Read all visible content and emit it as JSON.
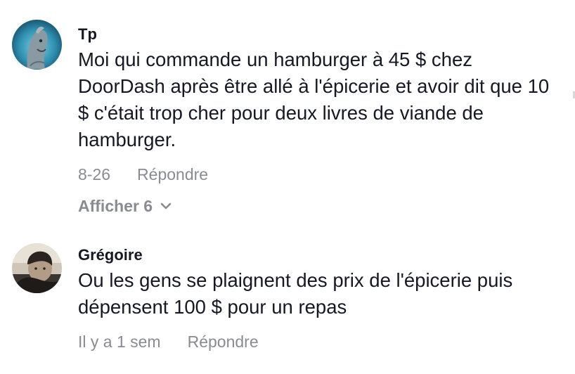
{
  "comments": [
    {
      "username": "Tp",
      "text": "Moi qui commande un hamburger à 45 $ chez DoorDash après être allé à l'épicerie et avoir dit que 10 $ c'était trop cher pour deux livres de viande de hamburger.",
      "date": "8-26",
      "reply_label": "Répondre",
      "view_replies_label": "Afficher 6",
      "avatar_icon": "dolphin-avatar"
    },
    {
      "username": "Grégoire",
      "text": "Ou les gens se plaignent des prix de l'épicerie puis dépensent 100 $ pour un repas",
      "date": "Il y a 1 sem",
      "reply_label": "Répondre",
      "avatar_icon": "person-avatar"
    }
  ],
  "colors": {
    "text": "#161823",
    "muted": "#8a8b91",
    "background": "#ffffff"
  }
}
